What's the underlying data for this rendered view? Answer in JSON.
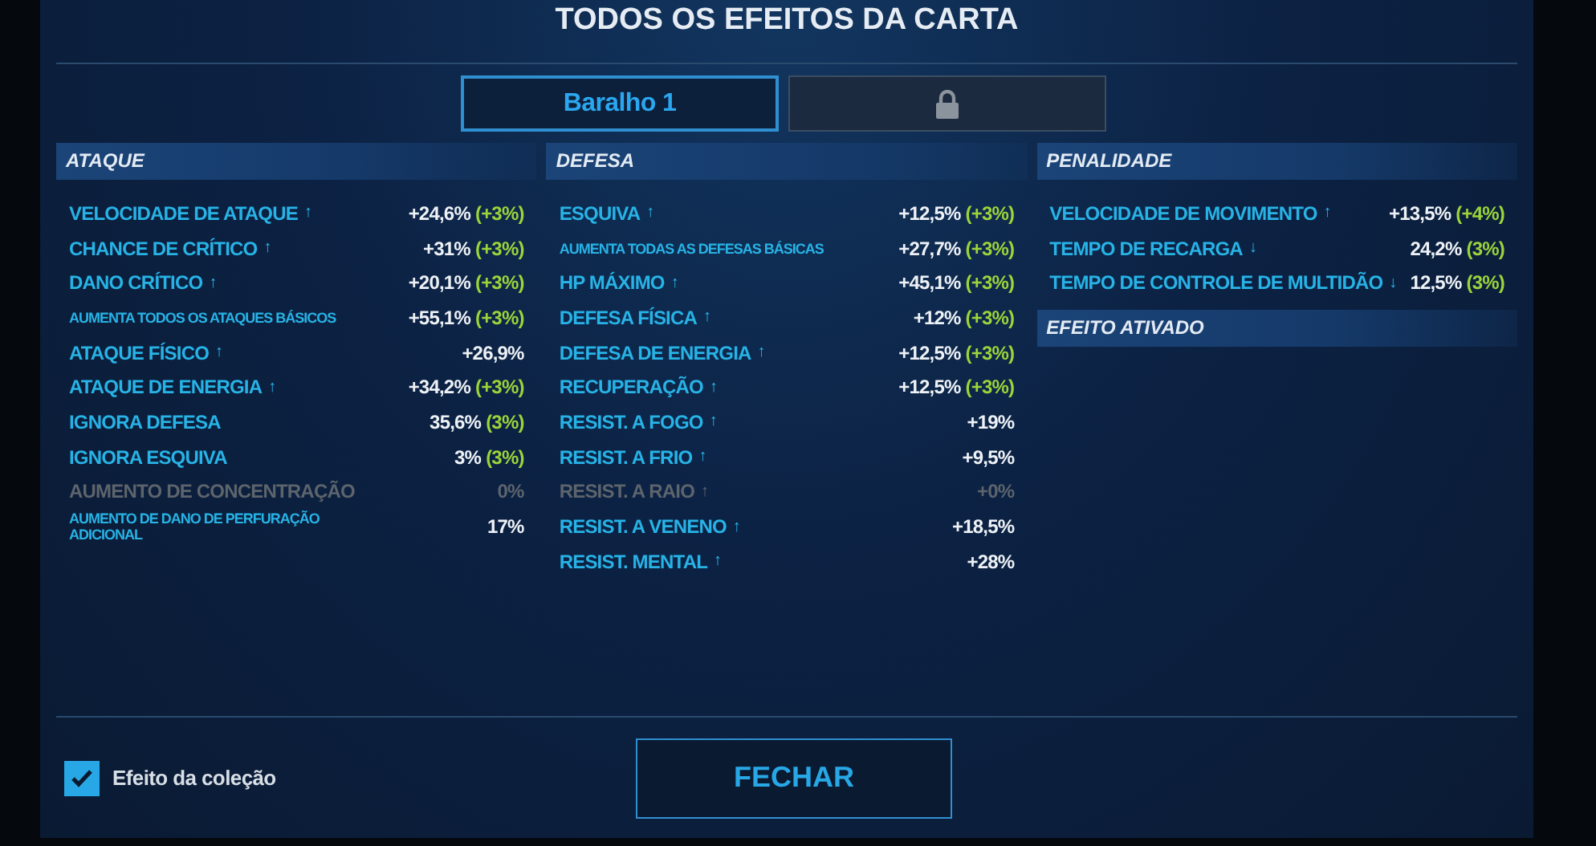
{
  "title": "TODOS OS EFEITOS DA CARTA",
  "tabs": [
    {
      "label": "Baralho 1",
      "kind": "text",
      "selected": true
    },
    {
      "kind": "locked",
      "selected": false
    }
  ],
  "columns": [
    {
      "sections": [
        {
          "title": "ATAQUE",
          "rows": [
            {
              "kind": "normal",
              "name": "VELOCIDADE DE ATAQUE",
              "arrow": "↑",
              "value": "+24,6%",
              "bonus": "(+3%)",
              "disabled": false
            },
            {
              "kind": "normal",
              "name": "CHANCE DE CRÍTICO",
              "arrow": "↑",
              "value": "+31%",
              "bonus": "(+3%)",
              "disabled": false
            },
            {
              "kind": "normal",
              "name": "DANO CRÍTICO",
              "arrow": "↑",
              "value": "+20,1%",
              "bonus": "(+3%)",
              "disabled": false
            },
            {
              "kind": "small",
              "name": "AUMENTA TODOS OS ATAQUES BÁSICOS",
              "value": "+55,1%",
              "bonus": "(+3%)",
              "disabled": false
            },
            {
              "kind": "normal",
              "name": "ATAQUE FÍSICO",
              "arrow": "↑",
              "value": "+26,9%",
              "disabled": false
            },
            {
              "kind": "normal",
              "name": "ATAQUE DE ENERGIA",
              "arrow": "↑",
              "value": "+34,2%",
              "bonus": "(+3%)",
              "disabled": false
            },
            {
              "kind": "normal",
              "name": "IGNORA DEFESA",
              "value": "35,6%",
              "bonus": "(3%)",
              "disabled": false
            },
            {
              "kind": "normal",
              "name": "IGNORA ESQUIVA",
              "value": "3%",
              "bonus": "(3%)",
              "disabled": false
            },
            {
              "kind": "normal",
              "name": "AUMENTO DE CONCENTRAÇÃO",
              "value": "0%",
              "disabled": true
            },
            {
              "kind": "small",
              "name": "AUMENTO DE DANO DE PERFURAÇÃO ADICIONAL",
              "value": "17%",
              "disabled": false
            }
          ]
        }
      ]
    },
    {
      "sections": [
        {
          "title": "DEFESA",
          "rows": [
            {
              "kind": "normal",
              "name": "ESQUIVA",
              "arrow": "↑",
              "value": "+12,5%",
              "bonus": "(+3%)",
              "disabled": false
            },
            {
              "kind": "small",
              "name": "AUMENTA TODAS AS DEFESAS BÁSICAS",
              "value": "+27,7%",
              "bonus": "(+3%)",
              "disabled": false
            },
            {
              "kind": "normal",
              "name": "HP MÁXIMO",
              "arrow": "↑",
              "value": "+45,1%",
              "bonus": "(+3%)",
              "disabled": false
            },
            {
              "kind": "normal",
              "name": "DEFESA FÍSICA",
              "arrow": "↑",
              "value": "+12%",
              "bonus": "(+3%)",
              "disabled": false
            },
            {
              "kind": "normal",
              "name": "DEFESA DE ENERGIA",
              "arrow": "↑",
              "value": "+12,5%",
              "bonus": "(+3%)",
              "disabled": false
            },
            {
              "kind": "normal",
              "name": "RECUPERAÇÃO",
              "arrow": "↑",
              "value": "+12,5%",
              "bonus": "(+3%)",
              "disabled": false
            },
            {
              "kind": "normal",
              "name": "RESIST. A FOGO",
              "arrow": "↑",
              "value": "+19%",
              "disabled": false
            },
            {
              "kind": "normal",
              "name": "RESIST. A FRIO",
              "arrow": "↑",
              "value": "+9,5%",
              "disabled": false
            },
            {
              "kind": "normal",
              "name": "RESIST. A RAIO",
              "arrow": "↑",
              "value": "+0%",
              "disabled": true
            },
            {
              "kind": "normal",
              "name": "RESIST. A VENENO",
              "arrow": "↑",
              "value": "+18,5%",
              "disabled": false
            },
            {
              "kind": "normal",
              "name": "RESIST. MENTAL",
              "arrow": "↑",
              "value": "+28%",
              "disabled": false
            }
          ]
        }
      ]
    },
    {
      "sections": [
        {
          "title": "PENALIDADE",
          "rows": [
            {
              "kind": "normal",
              "name": "VELOCIDADE DE MOVIMENTO",
              "arrow": "↑",
              "value": "+13,5%",
              "bonus": "(+4%)",
              "disabled": false
            },
            {
              "kind": "normal",
              "name": "TEMPO DE RECARGA",
              "arrow": "↓",
              "value": "24,2%",
              "bonus": "(3%)",
              "disabled": false
            },
            {
              "kind": "normal",
              "name": "TEMPO DE CONTROLE DE MULTIDÃO",
              "arrow": "↓",
              "value": "12,5%",
              "bonus": "(3%)",
              "disabled": false
            }
          ]
        },
        {
          "title": "EFEITO ATIVADO"
        }
      ]
    }
  ],
  "collection": {
    "label": "Efeito da coleção",
    "checked": true
  },
  "close_button": "FECHAR"
}
